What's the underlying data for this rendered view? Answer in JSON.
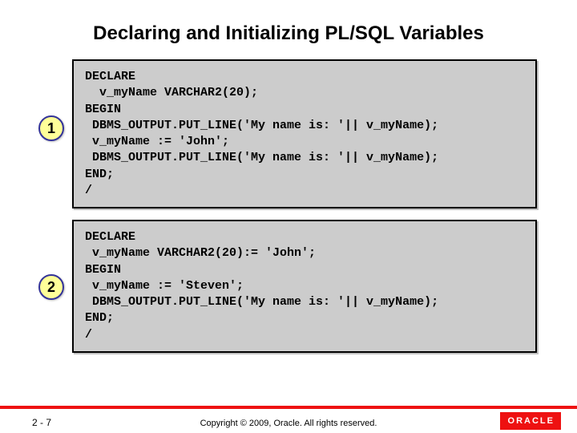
{
  "title": "Declaring and Initializing PL/SQL Variables",
  "markers": {
    "m1": "1",
    "m2": "2"
  },
  "code": {
    "block1": "DECLARE\n  v_myName VARCHAR2(20);\nBEGIN\n DBMS_OUTPUT.PUT_LINE('My name is: '|| v_myName);\n v_myName := 'John';\n DBMS_OUTPUT.PUT_LINE('My name is: '|| v_myName);\nEND;\n/",
    "block2": "DECLARE\n v_myName VARCHAR2(20):= 'John';\nBEGIN\n v_myName := 'Steven';\n DBMS_OUTPUT.PUT_LINE('My name is: '|| v_myName);\nEND;\n/"
  },
  "footer": {
    "page": "2 - 7",
    "copyright": "Copyright © 2009, Oracle. All rights reserved.",
    "logo": "ORACLE"
  }
}
